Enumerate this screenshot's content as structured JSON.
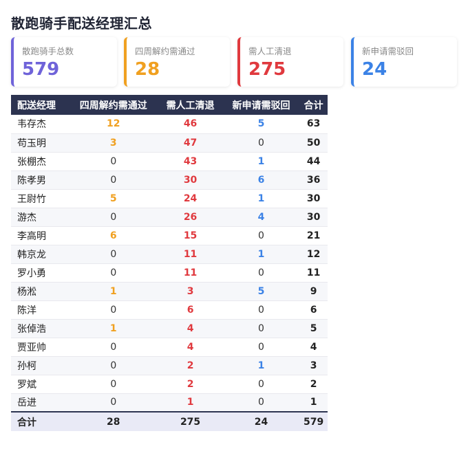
{
  "page": {
    "title": "散跑骑手配送经理汇总"
  },
  "cards": [
    {
      "label": "散跑骑手总数",
      "value": "579",
      "color": "#6f63d9"
    },
    {
      "label": "四周解约需通过",
      "value": "28",
      "color": "#f0a020"
    },
    {
      "label": "需人工清退",
      "value": "275",
      "color": "#e0393e"
    },
    {
      "label": "新申请需驳回",
      "value": "24",
      "color": "#3b82e6"
    }
  ],
  "table": {
    "headers": [
      "配送经理",
      "四周解约需通过",
      "需人工清退",
      "新申请需驳回",
      "合计"
    ],
    "rows": [
      {
        "name": "韦存杰",
        "a": "12",
        "b": "46",
        "c": "5",
        "total": "63"
      },
      {
        "name": "苟玉明",
        "a": "3",
        "b": "47",
        "c": "0",
        "total": "50"
      },
      {
        "name": "张棚杰",
        "a": "0",
        "b": "43",
        "c": "1",
        "total": "44"
      },
      {
        "name": "陈孝男",
        "a": "0",
        "b": "30",
        "c": "6",
        "total": "36"
      },
      {
        "name": "王尉竹",
        "a": "5",
        "b": "24",
        "c": "1",
        "total": "30"
      },
      {
        "name": "游杰",
        "a": "0",
        "b": "26",
        "c": "4",
        "total": "30"
      },
      {
        "name": "李高明",
        "a": "6",
        "b": "15",
        "c": "0",
        "total": "21"
      },
      {
        "name": "韩京龙",
        "a": "0",
        "b": "11",
        "c": "1",
        "total": "12"
      },
      {
        "name": "罗小勇",
        "a": "0",
        "b": "11",
        "c": "0",
        "total": "11"
      },
      {
        "name": "杨淞",
        "a": "1",
        "b": "3",
        "c": "5",
        "total": "9"
      },
      {
        "name": "陈洋",
        "a": "0",
        "b": "6",
        "c": "0",
        "total": "6"
      },
      {
        "name": "张倬浩",
        "a": "1",
        "b": "4",
        "c": "0",
        "total": "5"
      },
      {
        "name": "贾亚帅",
        "a": "0",
        "b": "4",
        "c": "0",
        "total": "4"
      },
      {
        "name": "孙柯",
        "a": "0",
        "b": "2",
        "c": "1",
        "total": "3"
      },
      {
        "name": "罗斌",
        "a": "0",
        "b": "2",
        "c": "0",
        "total": "2"
      },
      {
        "name": "岳进",
        "a": "0",
        "b": "1",
        "c": "0",
        "total": "1"
      }
    ],
    "footer": {
      "label": "合计",
      "a": "28",
      "b": "275",
      "c": "24",
      "total": "579"
    }
  }
}
